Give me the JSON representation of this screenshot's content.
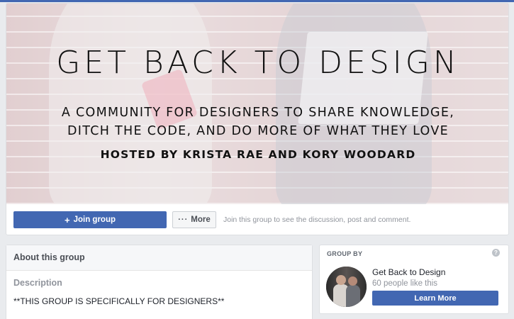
{
  "cover": {
    "title": "GET BACK TO DESIGN",
    "subtitle_line1": "A COMMUNITY FOR DESIGNERS TO SHARE KNOWLEDGE,",
    "subtitle_line2": "DITCH THE CODE, AND DO MORE OF WHAT THEY LOVE",
    "hosts": "HOSTED BY KRISTA RAE AND KORY WOODARD"
  },
  "actions": {
    "join_icon": "plus-icon",
    "join_label": "Join group",
    "more_icon": "ellipsis-icon",
    "more_label": "More",
    "hint": "Join this group to see the discussion, post and comment."
  },
  "about": {
    "header": "About this group",
    "description_label": "Description",
    "description_text": "**THIS GROUP IS SPECIFICALLY FOR DESIGNERS**"
  },
  "group_by": {
    "label": "GROUP BY",
    "help_icon": "question-icon",
    "page_name": "Get Back to Design",
    "likes": "60 people like this",
    "learn_more": "Learn More"
  },
  "colors": {
    "brand_blue": "#4267b2",
    "page_bg": "#e9ebee",
    "muted_text": "#90949c"
  }
}
